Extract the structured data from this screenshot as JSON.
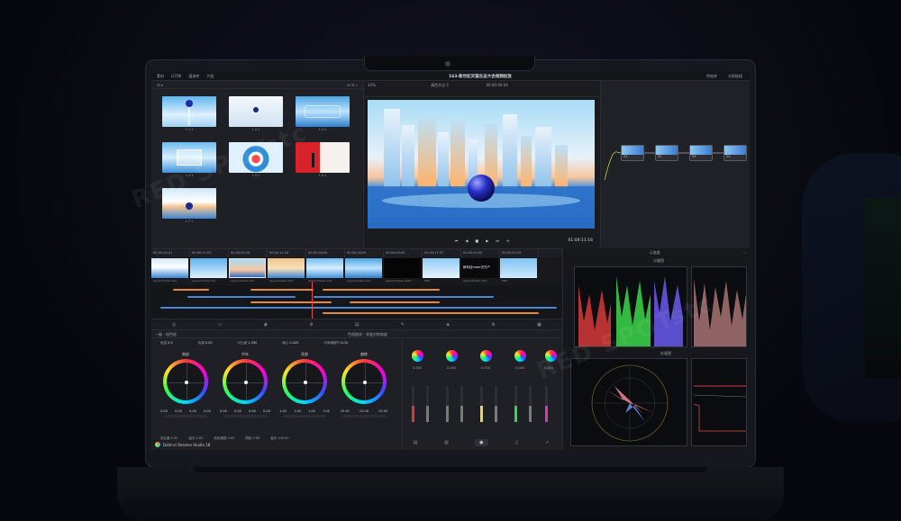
{
  "project_title": "163-新世纪天猫生态大会视频投放",
  "top_menu": [
    "素材",
    "LUT库",
    "媒体库",
    "片段"
  ],
  "top_right": [
    "特效库",
    "光照链接"
  ],
  "viewer": {
    "zoom": "33%",
    "clip_name": "调色节点-1",
    "source_tc": "00:00:06:04",
    "timecode": "01:00:11:16"
  },
  "media_pool_clips": [
    "1.1.1",
    "1.2.1",
    "1.3.1",
    "1.4.1",
    "1.5.1",
    "1.6.1",
    "1.7.1"
  ],
  "nodes": [
    "01",
    "02",
    "03",
    "04"
  ],
  "timeline": {
    "timecodes": [
      "00:00:10:01",
      "00:00:11:03",
      "00:00:05:16",
      "00:00:12:16",
      "00:00:16:00",
      "00:00:16:00",
      "00:00:00:00",
      "00:00:17:07",
      "00:00:00:00",
      "00:00:20:19"
    ],
    "clip_labels": [
      "Apple ProRes 422",
      "Apple ProRes 422",
      "Apple ProRes 422",
      "Apple ProRes 422",
      "Apple ProRes 422",
      "Apple ProRes 422",
      "Apple ProRes 4444",
      "PNG",
      "Apple ProRes 422",
      "PNG"
    ],
    "title_clip_text": "新科技mate天外产"
  },
  "scopes": {
    "header": "示波器",
    "parade_label": "分量图",
    "vector_label": "矢量图"
  },
  "color_panel": {
    "tab_left": "一级 - 校色轮",
    "tab_mid": "色相曲线 - 亮度对饱和度",
    "params": [
      {
        "label": "色温",
        "value": "0.0"
      },
      {
        "label": "色调",
        "value": "0.00"
      },
      {
        "label": "对比度",
        "value": "1.000"
      },
      {
        "label": "轴心",
        "value": "0.435"
      },
      {
        "label": "中间调细节",
        "value": "0.00"
      }
    ],
    "wheels": [
      {
        "name": "暗部",
        "vals": [
          "0.00",
          "0.00",
          "0.00",
          "0.00"
        ]
      },
      {
        "name": "中灰",
        "vals": [
          "0.00",
          "0.00",
          "0.00",
          "0.00"
        ]
      },
      {
        "name": "亮部",
        "vals": [
          "1.00",
          "1.00",
          "1.00",
          "1.00"
        ]
      },
      {
        "name": "偏移",
        "vals": [
          "25.00",
          "25.00",
          "25.00"
        ]
      }
    ],
    "bottom_params": [
      {
        "label": "对比度",
        "value": "0.00"
      },
      {
        "label": "高光",
        "value": "0.00"
      },
      {
        "label": "色彩增强",
        "value": "0.00"
      },
      {
        "label": "阴影",
        "value": "0.00"
      },
      {
        "label": "高光",
        "value": "100.00"
      }
    ],
    "mini_vals": [
      "0.000",
      "0.000",
      "0.000",
      "0.000",
      "0.000"
    ],
    "brand": "DaVinci Resolve Studio 18"
  },
  "watermark_text": "RED SPOTstc",
  "colors": {
    "playhead": "#e84c3d",
    "track_orange": "#e8893a",
    "track_blue": "#4a86d6"
  }
}
